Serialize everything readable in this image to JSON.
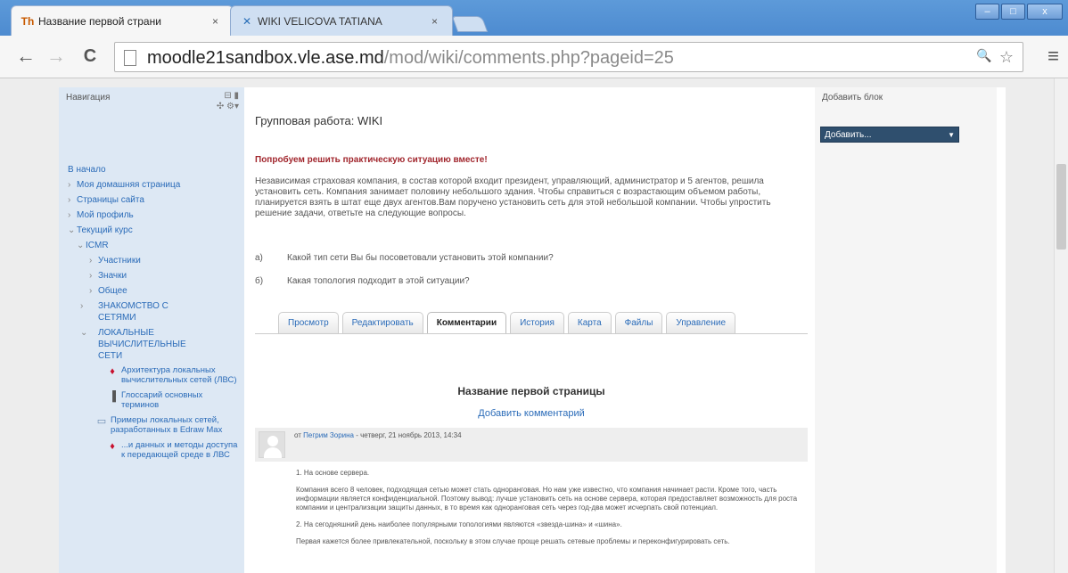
{
  "browser": {
    "tabs": [
      {
        "title": "Название первой страни",
        "close": "×",
        "favicon": "Th"
      },
      {
        "title": "WIKI VELICOVA TATIANA",
        "close": "×",
        "favicon": "✕"
      }
    ],
    "window_controls": {
      "minimize": "–",
      "maximize": "□",
      "close": "x"
    },
    "url_host": "moodle21sandbox.vle.ase.md",
    "url_path": "/mod/wiki/comments.php?pageid=25",
    "nav": {
      "back": "←",
      "forward": "→",
      "reload": "C"
    },
    "omnibox_icons": {
      "search": "🔍",
      "star": "☆"
    },
    "menu": "≡"
  },
  "nav_block": {
    "header": "Навигация",
    "controls_line1": "⊟ ▮",
    "controls_line2": "✣ ⚙▾",
    "items": [
      {
        "label": "В начало"
      },
      {
        "label": "Моя домашняя страница"
      },
      {
        "label": "Страницы сайта"
      },
      {
        "label": "Мой профиль"
      },
      {
        "label": "Текущий курс"
      },
      {
        "label": "ICMR"
      },
      {
        "label": "Участники"
      },
      {
        "label": "Значки"
      },
      {
        "label": "Общее"
      },
      {
        "label": "ЗНАКОМСТВО С СЕТЯМИ"
      },
      {
        "label": "ЛОКАЛЬНЫЕ ВЫЧИСЛИТЕЛЬНЫЕ СЕТИ"
      }
    ],
    "resources": [
      {
        "label": "Архитектура локальных вычислительных сетей (ЛВС)"
      },
      {
        "label": "Глоссарий основных терминов"
      },
      {
        "label": "Примеры локальных сетей, разработанных в Edraw Max"
      },
      {
        "label": "...и данных и методы доступа к передающей среде в ЛВС"
      }
    ]
  },
  "main": {
    "title": "Групповая работа: WIKI",
    "red_heading": "Попробуем решить практическую ситуацию вместе!",
    "paragraph": "Независимая страховая компания, в состав которой входит президент, управляющий, администратор и 5 агентов, решила установить сеть. Компания занимает половину небольшого здания. Чтобы справиться с возрастающим объемом работы, планируется взять в штат еще двух агентов.Вам поручено установить сеть для этой небольшой компании. Чтобы упростить решение задачи, ответьте на следующие вопросы.",
    "questions": [
      {
        "num": "а)",
        "text": "Какой тип сети Вы бы посоветовали установить этой компании?"
      },
      {
        "num": "б)",
        "text": "Какая топология подходит в этой ситуации?"
      }
    ],
    "tabs": [
      "Просмотр",
      "Редактировать",
      "Комментарии",
      "История",
      "Карта",
      "Файлы",
      "Управление"
    ],
    "page_heading": "Название первой страницы",
    "add_comment": "Добавить комментарий",
    "comment": {
      "author_prefix": "от",
      "author": "Пегрим Зорина",
      "date": " - четверг, 21 ноябрь 2013, 14:34",
      "paragraphs": [
        "1. На основе сервера.",
        "Компания всего 8 человек, подходящая сетью может стать одноранговая. Но нам уже известно, что компания начинает расти. Кроме того, часть информации является конфиденциальной. Поэтому вывод: лучше установить сеть на основе сервера, которая предоставляет возможность для роста компании и централизации защиты данных, в то время как одноранговая сеть через год-два может исчерпать свой потенциал.",
        "2. На сегодняшний день наиболее популярными топологиями являются «звезда-шина» и «шина».",
        "Первая кажется более привлекательной, поскольку в этом случае проще решать сетевые проблемы и переконфигурировать сеть."
      ]
    }
  },
  "right_block": {
    "header": "Добавить блок",
    "select_value": "Добавить...",
    "caret": "▼"
  }
}
